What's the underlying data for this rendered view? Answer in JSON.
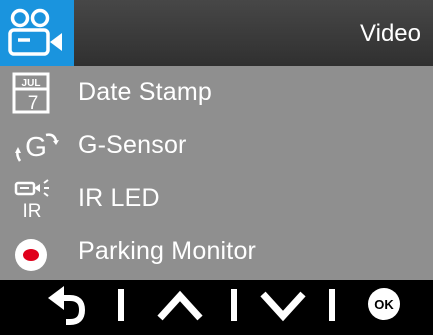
{
  "header": {
    "title": "Video",
    "icon": "video-settings-icon"
  },
  "menu": {
    "items": [
      {
        "label": "Date Stamp",
        "icon": "calendar-icon"
      },
      {
        "label": "G-Sensor",
        "icon": "g-sensor-icon"
      },
      {
        "label": "IR LED",
        "icon": "ir-led-icon",
        "icon_text": "IR"
      },
      {
        "label": "Parking Monitor",
        "icon": "record-icon"
      }
    ],
    "calendar_month": "JUL",
    "calendar_day": "7",
    "g_sensor_letter": "G"
  },
  "footer": {
    "ok_label": "OK",
    "buttons": [
      "back",
      "up",
      "down",
      "ok"
    ]
  },
  "colors": {
    "accent": "#1a94de",
    "menu_bg": "#8f8f8f",
    "record_red": "#e0001b"
  }
}
